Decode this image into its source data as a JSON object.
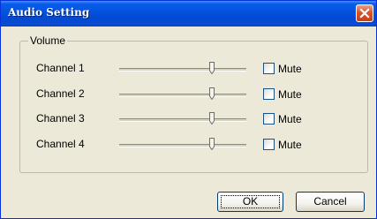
{
  "window": {
    "title": "Audio Setting",
    "close_icon": "close-x-icon"
  },
  "group": {
    "label": "Volume"
  },
  "channels": [
    {
      "label": "Channel 1",
      "volume": 0.74,
      "muted": false,
      "mute_label": "Mute"
    },
    {
      "label": "Channel 2",
      "volume": 0.74,
      "muted": false,
      "mute_label": "Mute"
    },
    {
      "label": "Channel 3",
      "volume": 0.74,
      "muted": false,
      "mute_label": "Mute"
    },
    {
      "label": "Channel 4",
      "volume": 0.74,
      "muted": false,
      "mute_label": "Mute"
    }
  ],
  "buttons": {
    "ok": "OK",
    "cancel": "Cancel"
  },
  "colors": {
    "titlebar": "#0454e0",
    "window_bg": "#ece9d8",
    "close_button": "#d9542c"
  }
}
